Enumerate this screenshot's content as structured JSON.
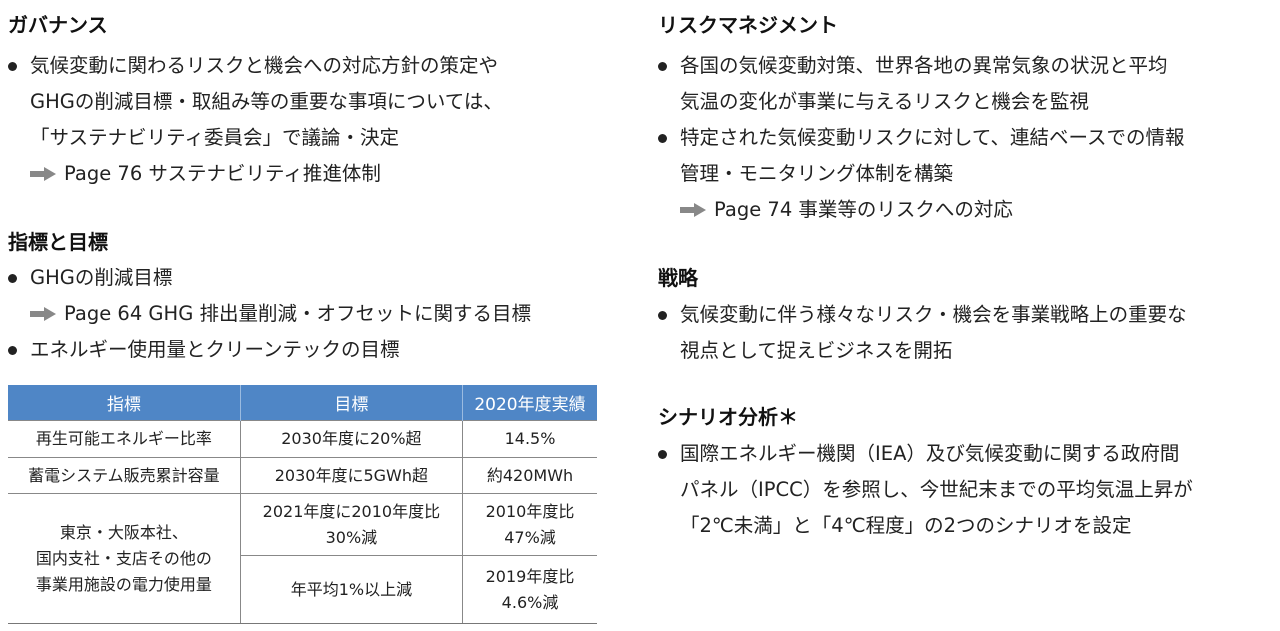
{
  "governance": {
    "heading": "ガバナンス",
    "bullets": [
      {
        "lines": [
          "気候変動に関わるリスクと機会への対応方針の策定や",
          "GHGの削減目標・取組み等の重要な事項については、",
          "「サステナビリティ委員会」で議論・決定"
        ]
      }
    ],
    "ref": {
      "icon": "arrow-right-icon",
      "text": "Page 76 サステナビリティ推進体制"
    }
  },
  "metrics": {
    "heading": "指標と目標",
    "bullets": [
      {
        "text": "GHGの削減目標"
      },
      {
        "text": "エネルギー使用量とクリーンテックの目標"
      }
    ],
    "ref": {
      "icon": "arrow-right-icon",
      "text": "Page 64 GHG 排出量削減・オフセットに関する目標"
    },
    "table": {
      "headers": [
        "指標",
        "目標",
        "2020年度実績"
      ],
      "header_color": "#4f86c6",
      "rows": [
        {
          "indicator": "再生可能エネルギー比率",
          "target": "2030年度に20%超",
          "result": "14.5%"
        },
        {
          "indicator": "蓄電システム販売累計容量",
          "target": "2030年度に5GWh超",
          "result": "約420MWh"
        }
      ],
      "merged": {
        "indicator_lines": [
          "東京・大阪本社、",
          "国内支社・支店その他の",
          "事業用施設の電力使用量"
        ],
        "subrows": [
          {
            "target_lines": [
              "2021年度に2010年度比",
              "30%減"
            ],
            "result_lines": [
              "2010年度比",
              "47%減"
            ]
          },
          {
            "target_lines": [
              "年平均1%以上減"
            ],
            "result_lines": [
              "2019年度比",
              "4.6%減"
            ]
          }
        ]
      }
    }
  },
  "risk": {
    "heading": "リスクマネジメント",
    "bullets": [
      {
        "lines": [
          "各国の気候変動対策、世界各地の異常気象の状況と平均",
          "気温の変化が事業に与えるリスクと機会を監視"
        ]
      },
      {
        "lines": [
          "特定された気候変動リスクに対して、連結ベースでの情報",
          "管理・モニタリング体制を構築"
        ]
      }
    ],
    "ref": {
      "icon": "arrow-right-icon",
      "text": "Page 74 事業等のリスクへの対応"
    }
  },
  "strategy": {
    "heading": "戦略",
    "bullets": [
      {
        "lines": [
          "気候変動に伴う様々なリスク・機会を事業戦略上の重要な",
          "視点として捉えビジネスを開拓"
        ]
      }
    ]
  },
  "scenario": {
    "heading": "シナリオ分析＊",
    "bullets": [
      {
        "lines": [
          "国際エネルギー機関（IEA）及び気候変動に関する政府間",
          "パネル（IPCC）を参照し、今世紀末までの平均気温上昇が",
          "「2℃未満」と「4℃程度」の2つのシナリオを設定"
        ]
      }
    ]
  }
}
